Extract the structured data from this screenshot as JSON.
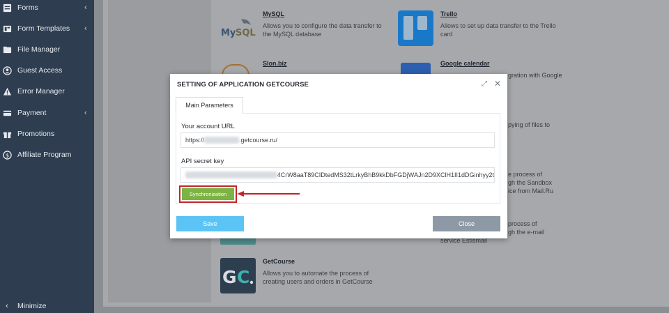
{
  "sidebar": {
    "items": [
      {
        "label": "Forms",
        "icon": "forms-icon",
        "has_chevron": true
      },
      {
        "label": "Form Templates",
        "icon": "form-templates-icon",
        "has_chevron": true
      },
      {
        "label": "File Manager",
        "icon": "file-manager-icon",
        "has_chevron": false
      },
      {
        "label": "Guest Access",
        "icon": "guest-access-icon",
        "has_chevron": false
      },
      {
        "label": "Error Manager",
        "icon": "warning-icon",
        "has_chevron": false
      },
      {
        "label": "Payment",
        "icon": "payment-icon",
        "has_chevron": true
      },
      {
        "label": "Promotions",
        "icon": "gift-icon",
        "has_chevron": false
      },
      {
        "label": "Affiliate Program",
        "icon": "dollar-icon",
        "has_chevron": false
      }
    ],
    "minimize_label": "Minimize",
    "chevron": "‹"
  },
  "apps": {
    "mysql": {
      "name": "MySQL",
      "desc": "Allows you to configure the data transfer to the MySQL database",
      "logo_text": "MySQL"
    },
    "trello": {
      "name": "Trello",
      "desc": "Allows to set up data transfer to the Trello card"
    },
    "slon": {
      "name": "Slon.biz"
    },
    "gcal": {
      "name": "Google calendar",
      "desc_fragment": "gration with Google"
    },
    "frag1": "pying of files to",
    "frag2a": "e process of",
    "frag2b": "gh the Sandbox",
    "frag2c": "ice from Mail.Ru",
    "frag3a": "process of",
    "frag3b": "gh the e-mail",
    "frag3c": "service Estismail",
    "getcourse": {
      "name": "GetCourse",
      "desc": "Allows you to automate the process of creating users and orders in GetCourse",
      "logo_text": "GC"
    }
  },
  "modal": {
    "title": "SETTING OF APPLICATION GETCOURSE",
    "tab_label": "Main Parameters",
    "url_label": "Your account URL",
    "url_prefix": "https://",
    "url_suffix": ".getcourse.ru/",
    "key_label": "API secret key",
    "key_visible": "4CrW8aaT89CIDtedMS32tLrkyBhB9kkDbFGDjWAJn2D9XClH1II1dDGinhyy2t",
    "sync_label": "Synchronization",
    "save_label": "Save",
    "close_label": "Close",
    "close_glyph": "✕",
    "max_glyph": "⤢"
  },
  "colors": {
    "sidebar_bg": "#2e3d50",
    "sync_green": "#7cb342",
    "highlight_red": "#c0262b",
    "save_blue": "#5bc4f5",
    "close_gray": "#8e99a6",
    "trello_blue": "#1a78c8",
    "getcourse_dark": "#2d3e4e"
  }
}
